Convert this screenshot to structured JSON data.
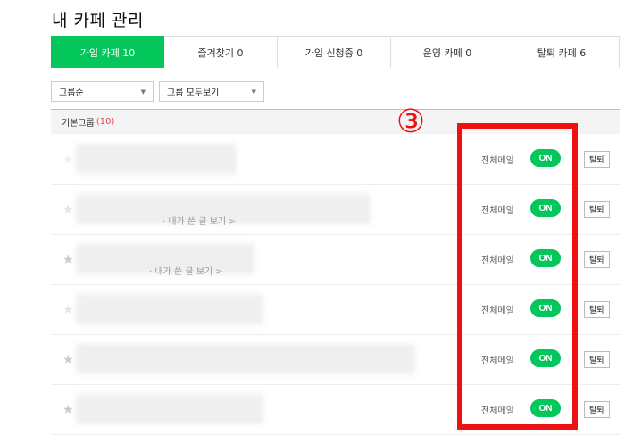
{
  "page_title": "내 카페 관리",
  "tabs": [
    {
      "label": "가입 카페 10",
      "active": true
    },
    {
      "label": "즐겨찾기 0",
      "active": false
    },
    {
      "label": "가입 신청중 0",
      "active": false
    },
    {
      "label": "운영 카페 0",
      "active": false
    },
    {
      "label": "탈퇴 카페 6",
      "active": false
    }
  ],
  "filters": {
    "sort": "그룹순",
    "group": "그룹 모두보기"
  },
  "group": {
    "name": "기본그룹",
    "count": "(10)"
  },
  "rows": [
    {
      "my_posts": "",
      "mail_label": "전체메일",
      "toggle": "ON",
      "leave": "탈퇴"
    },
    {
      "my_posts": "· 내가 쓴 글 보기 >",
      "mail_label": "전체메일",
      "toggle": "ON",
      "leave": "탈퇴"
    },
    {
      "my_posts": "· 내가 쓴 글 보기 >",
      "mail_label": "전체메일",
      "toggle": "ON",
      "leave": "탈퇴"
    },
    {
      "my_posts": "",
      "mail_label": "전체메일",
      "toggle": "ON",
      "leave": "탈퇴"
    },
    {
      "my_posts": "",
      "mail_label": "전체메일",
      "toggle": "ON",
      "leave": "탈퇴"
    },
    {
      "my_posts": "",
      "mail_label": "전체메일",
      "toggle": "ON",
      "leave": "탈퇴"
    }
  ],
  "annotation": {
    "number": "③",
    "color": "#ee1111"
  },
  "colors": {
    "accent": "#03c75a",
    "count_red": "#e5484d"
  },
  "icons": {
    "star": "★",
    "dropdown": "▼"
  }
}
